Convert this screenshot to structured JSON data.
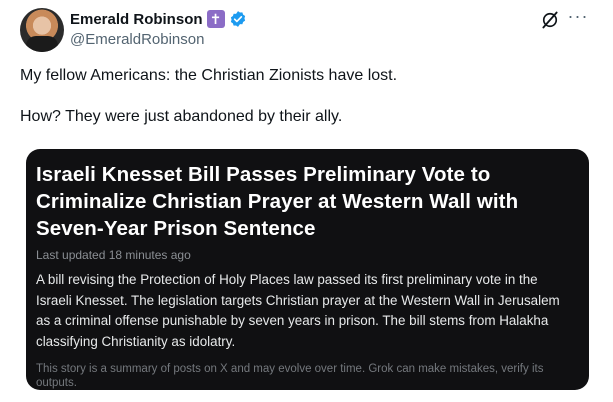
{
  "author": {
    "name": "Emerald Robinson",
    "badge_glyph": "✝",
    "handle": "@EmeraldRobinson",
    "verified_color": "#1d9bf0",
    "badge_color": "#8b6cc6"
  },
  "icons": {
    "grok": "grok-icon",
    "more": "more-icon"
  },
  "tweet": {
    "paragraphs": [
      "My fellow Americans: the Christian Zionists have lost.",
      "How? They were just abandoned by their ally."
    ]
  },
  "card": {
    "title": "Israeli Knesset Bill Passes Preliminary Vote to Criminalize Christian Prayer at Western Wall with Seven-Year Prison Sentence",
    "updated": "Last updated 18 minutes ago",
    "summary": "A bill revising the Protection of Holy Places law passed its first preliminary vote in the Israeli Knesset. The legislation targets Christian prayer at the Western Wall in Jerusalem as a criminal offense punishable by seven years in prison. The bill stems from Halakha classifying Christianity as idolatry.",
    "disclaimer": "This story is a summary of posts on X and may evolve over time. Grok can make mistakes, verify its outputs.",
    "background": "#101012"
  }
}
